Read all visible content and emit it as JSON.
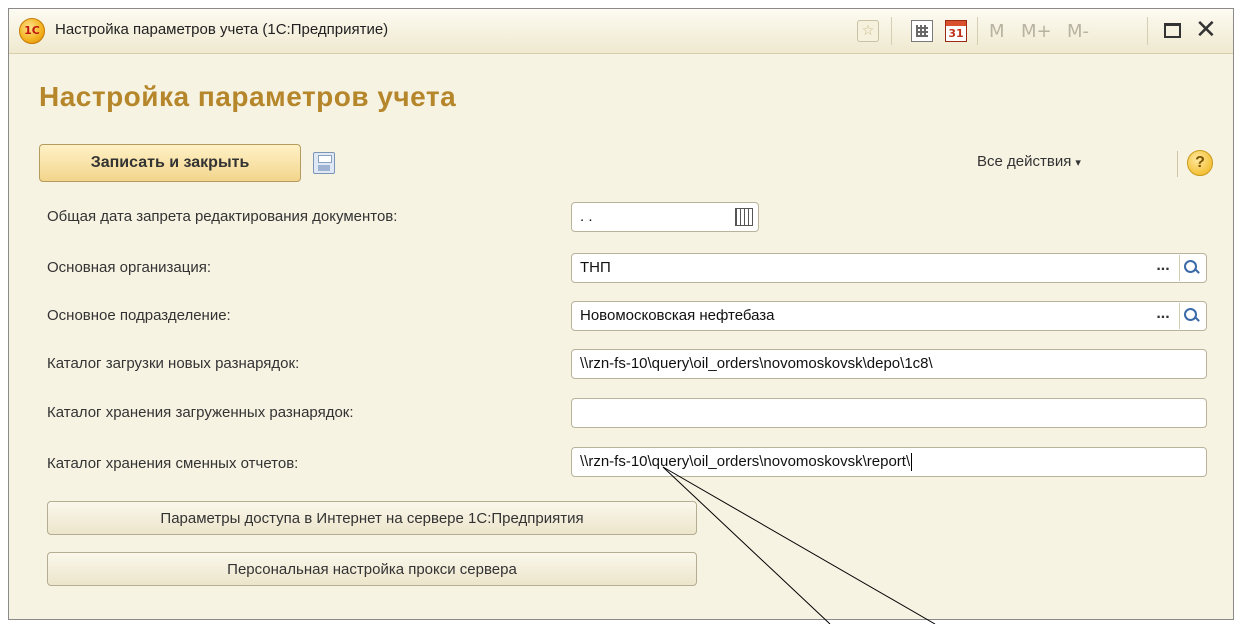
{
  "window": {
    "title": "Настройка параметров учета  (1С:Предприятие)",
    "logo_text": "1C",
    "toolbar_icons": [
      "favorite-icon",
      "calculator-icon",
      "calendar-icon"
    ],
    "calendar_day": "31",
    "memory_buttons": [
      "M",
      "M+",
      "M-"
    ],
    "close_glyph": "✕"
  },
  "form": {
    "heading": "Настройка параметров учета",
    "save_close_label": "Записать и закрыть",
    "all_actions_label": "Все действия",
    "help_label": "?",
    "fields": [
      {
        "label": "Общая дата запрета редактирования документов:",
        "value": " .  ."
      },
      {
        "label": "Основная организация:",
        "value": "ТНП"
      },
      {
        "label": "Основное подразделение:",
        "value": "Новомосковская нефтебаза"
      },
      {
        "label": "Каталог загрузки новых разнарядок:",
        "value": "\\\\rzn-fs-10\\query\\oil_orders\\novomoskovsk\\depo\\1c8\\"
      },
      {
        "label": "Каталог хранения загруженных разнарядок:",
        "value": ""
      },
      {
        "label": "Каталог хранения сменных отчетов:",
        "value": "\\\\rzn-fs-10\\query\\oil_orders\\novomoskovsk\\report\\"
      }
    ],
    "select_button": "...",
    "internet_button": "Параметры доступа в Интернет на сервере 1С:Предприятия",
    "proxy_button": "Персональная настройка прокси сервера"
  },
  "colors": {
    "heading": "#b5862a",
    "background": "#f7f3e3",
    "primary_button": "#f2d58c"
  }
}
